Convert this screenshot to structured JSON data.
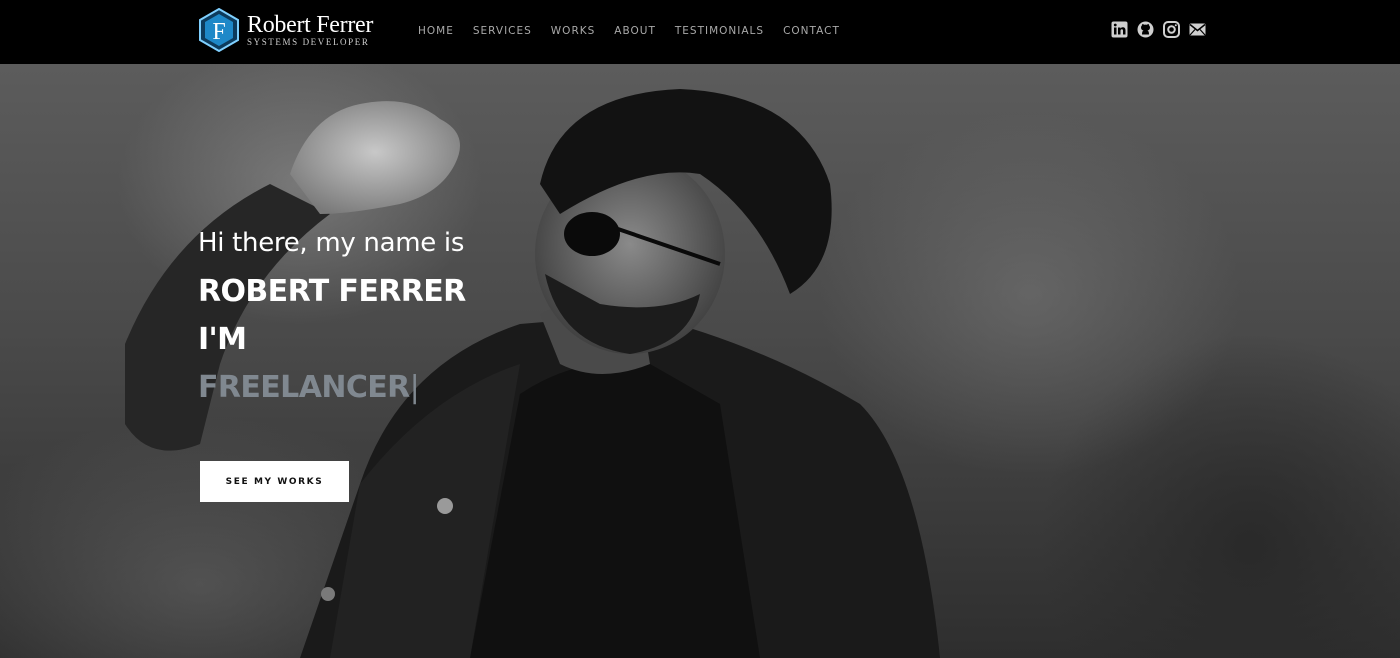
{
  "brand": {
    "logo_letter": "F",
    "name": "Robert Ferrer",
    "subtitle": "SYSTEMS DEVELOPER",
    "accent": "#2ea7e8"
  },
  "nav": {
    "items": [
      {
        "label": "HOME"
      },
      {
        "label": "SERVICES"
      },
      {
        "label": "WORKS"
      },
      {
        "label": "ABOUT"
      },
      {
        "label": "TESTIMONIALS"
      },
      {
        "label": "CONTACT"
      }
    ],
    "color": "#a9a9a9"
  },
  "social": [
    "linkedin-icon",
    "github-icon",
    "instagram-icon",
    "mail-icon"
  ],
  "hero": {
    "greeting": "Hi there, my name is",
    "name": "ROBERT FERRER",
    "prefix": "I'M",
    "role": "FREELANCER",
    "cursor": "|",
    "cta_label": "SEE MY WORKS",
    "role_color": "#808890"
  }
}
